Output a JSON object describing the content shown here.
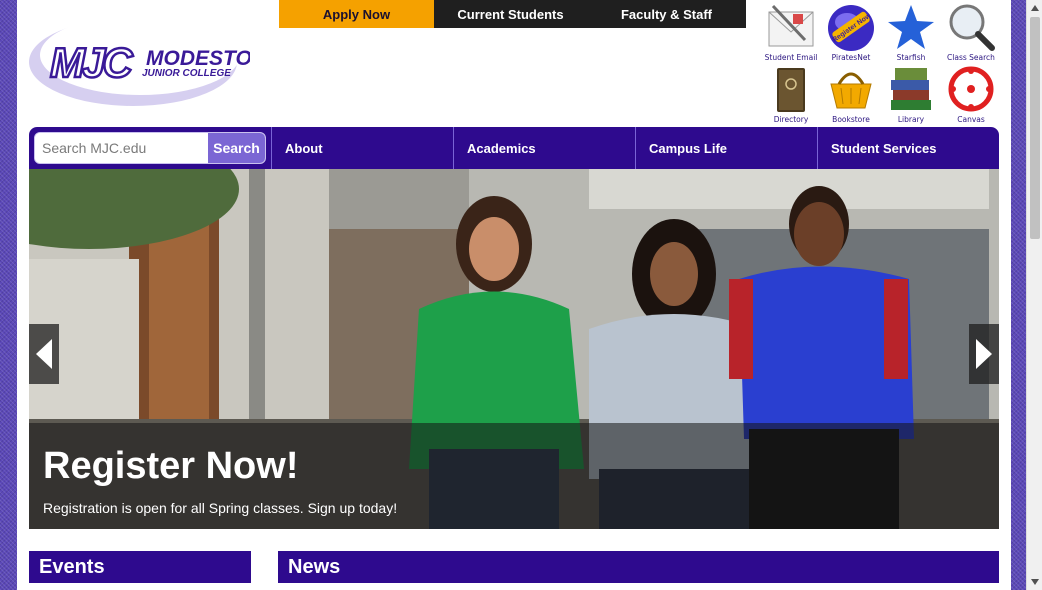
{
  "logo": {
    "line1": "MODESTO",
    "line2": "JUNIOR COLLEGE",
    "monogram": "MJC"
  },
  "topnav": {
    "apply": "Apply Now",
    "students": "Current Students",
    "faculty": "Faculty & Staff"
  },
  "quicklinks": [
    {
      "label": "Student Email",
      "icon": "envelope-icon"
    },
    {
      "label": "PiratesNet",
      "icon": "globe-icon",
      "badge": "Register Now"
    },
    {
      "label": "Starfish",
      "icon": "star-icon"
    },
    {
      "label": "Class Search",
      "icon": "magnifier-icon"
    },
    {
      "label": "Directory",
      "icon": "book-icon"
    },
    {
      "label": "Bookstore",
      "icon": "shopping-basket-icon"
    },
    {
      "label": "Library",
      "icon": "books-stack-icon"
    },
    {
      "label": "Canvas",
      "icon": "canvas-icon"
    }
  ],
  "search": {
    "placeholder": "Search MJC.edu",
    "button": "Search"
  },
  "nav": [
    "About",
    "Academics",
    "Campus Life",
    "Student Services"
  ],
  "hero": {
    "title": "Register Now!",
    "text": "Registration is open for all Spring classes. Sign up today!"
  },
  "sections": {
    "events": "Events",
    "news": "News"
  },
  "colors": {
    "brand_purple": "#2e0a8e",
    "accent_orange": "#f5a100",
    "search_button": "#7b66d4"
  }
}
